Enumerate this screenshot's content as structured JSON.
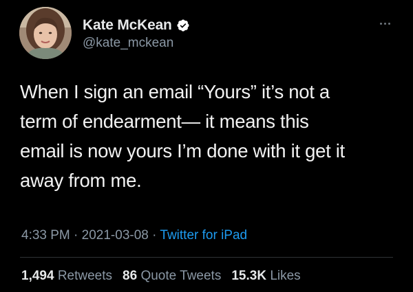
{
  "author": {
    "display_name": "Kate McKean",
    "handle": "@kate_mckean",
    "verified": true
  },
  "tweet": {
    "text_lines": [
      "When I sign an email “Yours” it’s not a",
      "term of endearment— it means this",
      "email is now yours I’m done with it get it",
      "away from me."
    ],
    "time": "4:33 PM",
    "sep1": "·",
    "date": "2021-03-08",
    "sep2": "·",
    "source": "Twitter for iPad"
  },
  "stats": {
    "retweets_count": "1,494",
    "retweets_label": "Retweets",
    "quotes_count": "86",
    "quotes_label": "Quote Tweets",
    "likes_count": "15.3K",
    "likes_label": "Likes"
  },
  "icons": {
    "verified": "verified-badge-icon",
    "more": "more-options-icon"
  },
  "colors": {
    "background": "#000000",
    "link": "#1d9bf0",
    "muted": "#8b98a5"
  }
}
